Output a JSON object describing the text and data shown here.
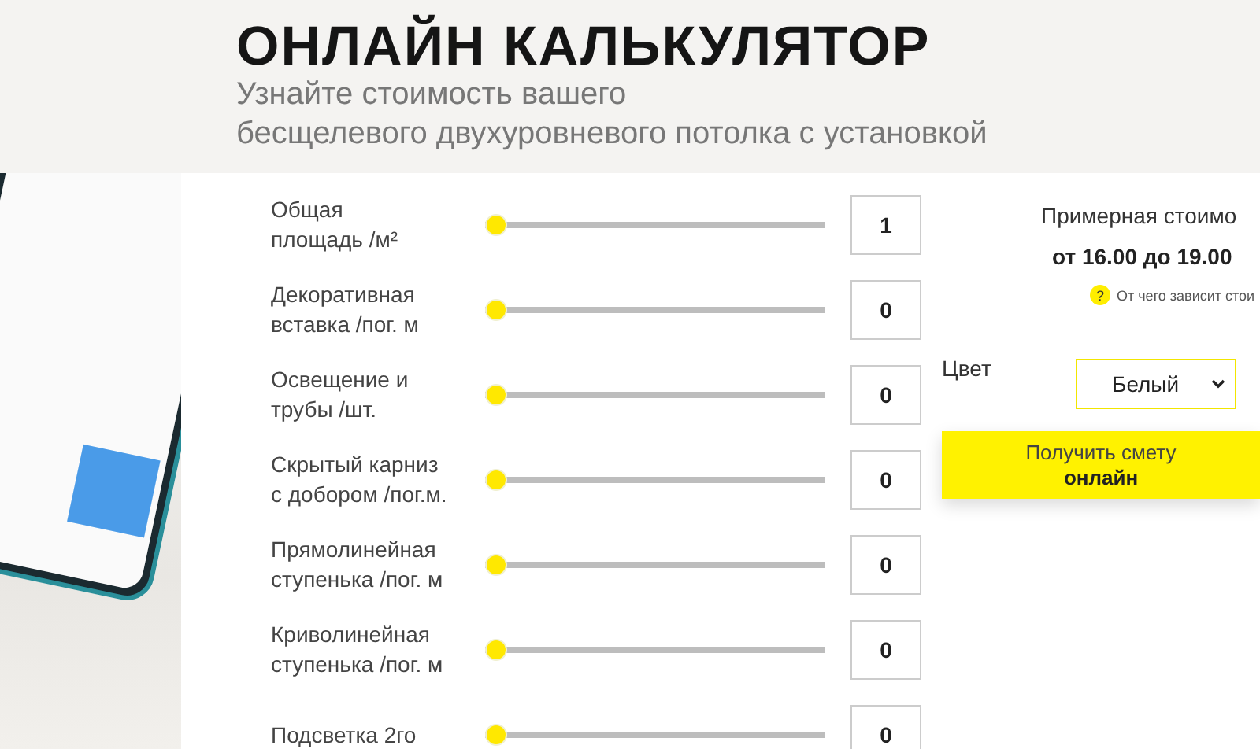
{
  "header": {
    "title": "ОНЛАЙН КАЛЬКУЛЯТОР",
    "subtitle_lines": [
      "Узнайте стоимость вашего",
      "бесщелевого двухуровневого потолка с установкой"
    ]
  },
  "sliders": [
    {
      "label_lines": [
        "Общая",
        "площадь /м²"
      ],
      "level": 0,
      "value": "1"
    },
    {
      "label_lines": [
        "Декоративная",
        "вставка /пог. м"
      ],
      "level": 0,
      "value": "0"
    },
    {
      "label_lines": [
        "Освещение и",
        "трубы /шт."
      ],
      "level": 0,
      "value": "0"
    },
    {
      "label_lines": [
        "Скрытый карниз",
        "с добором /пог.м."
      ],
      "level": 0,
      "value": "0"
    },
    {
      "label_lines": [
        "Прямолинейная",
        "ступенька /пог. м"
      ],
      "level": 0,
      "value": "0"
    },
    {
      "label_lines": [
        "Криволинейная",
        "ступенька /пог. м"
      ],
      "level": 0,
      "value": "0"
    },
    {
      "label_lines": [
        "Подсветка 2го"
      ],
      "level": 0,
      "value": "0"
    }
  ],
  "estimate": {
    "title": "Примерная стоимо",
    "price": "от 16.00 до 19.00",
    "help_icon": "?",
    "help_text": "От чего зависит стои"
  },
  "color_select": {
    "label": "Цвет",
    "value": "Белый"
  },
  "submit_button": {
    "line1": "Получить смету",
    "line2": "онлайн"
  }
}
